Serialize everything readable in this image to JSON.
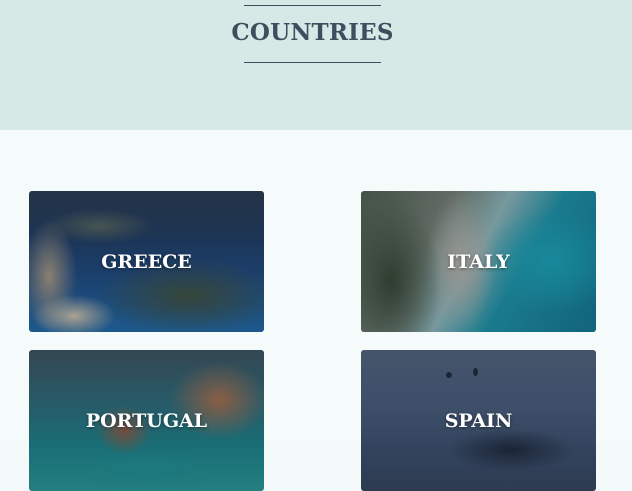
{
  "header": {
    "title": "COUNTRIES"
  },
  "countries": [
    {
      "label": "GREECE"
    },
    {
      "label": "ITALY"
    },
    {
      "label": "PORTUGAL"
    },
    {
      "label": "SPAIN"
    }
  ],
  "colors": {
    "hero_background": "#d6e9e6",
    "title_text": "#3d4f5f",
    "page_background": "#f5fafa",
    "card_label": "#ffffff"
  }
}
